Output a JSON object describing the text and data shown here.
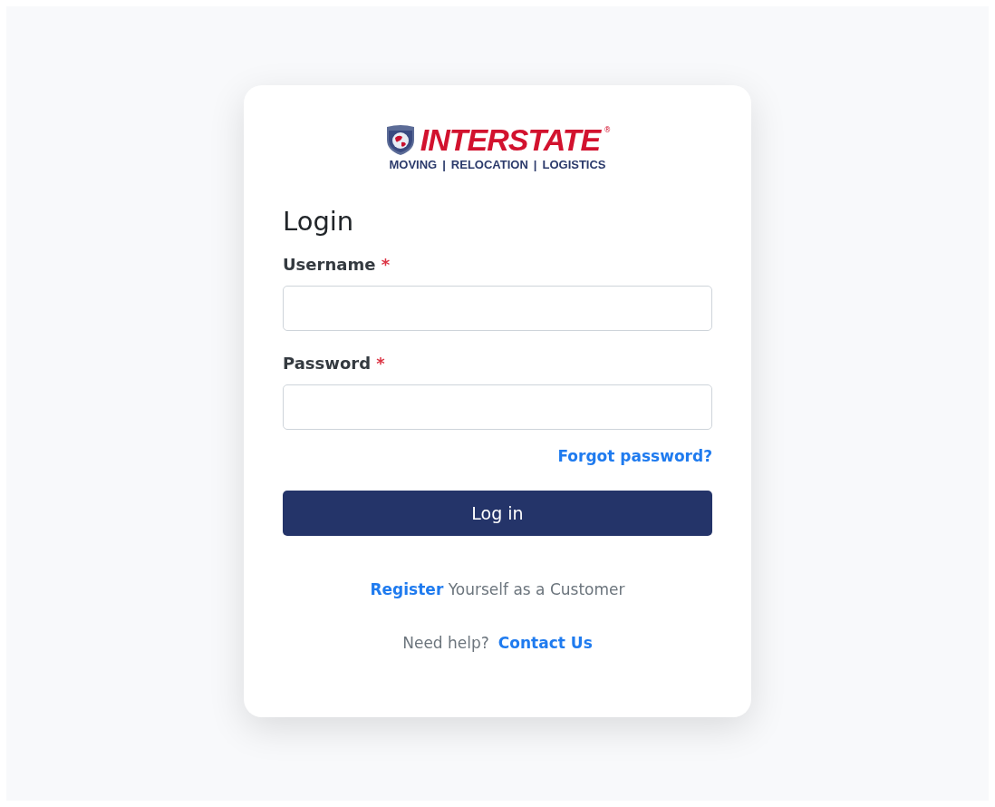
{
  "logo": {
    "name": "INTERSTATE",
    "mark": "®",
    "tagline": [
      "MOVING",
      "RELOCATION",
      "LOGISTICS"
    ],
    "separator": "|"
  },
  "title": "Login",
  "fields": [
    {
      "label": "Username",
      "required_mark": "*"
    },
    {
      "label": "Password",
      "required_mark": "*"
    }
  ],
  "forgot_link": "Forgot password?",
  "submit_button": "Log in",
  "register": {
    "link": "Register",
    "text": "Yourself as a Customer"
  },
  "help": {
    "text": "Need help?",
    "link": "Contact Us"
  }
}
